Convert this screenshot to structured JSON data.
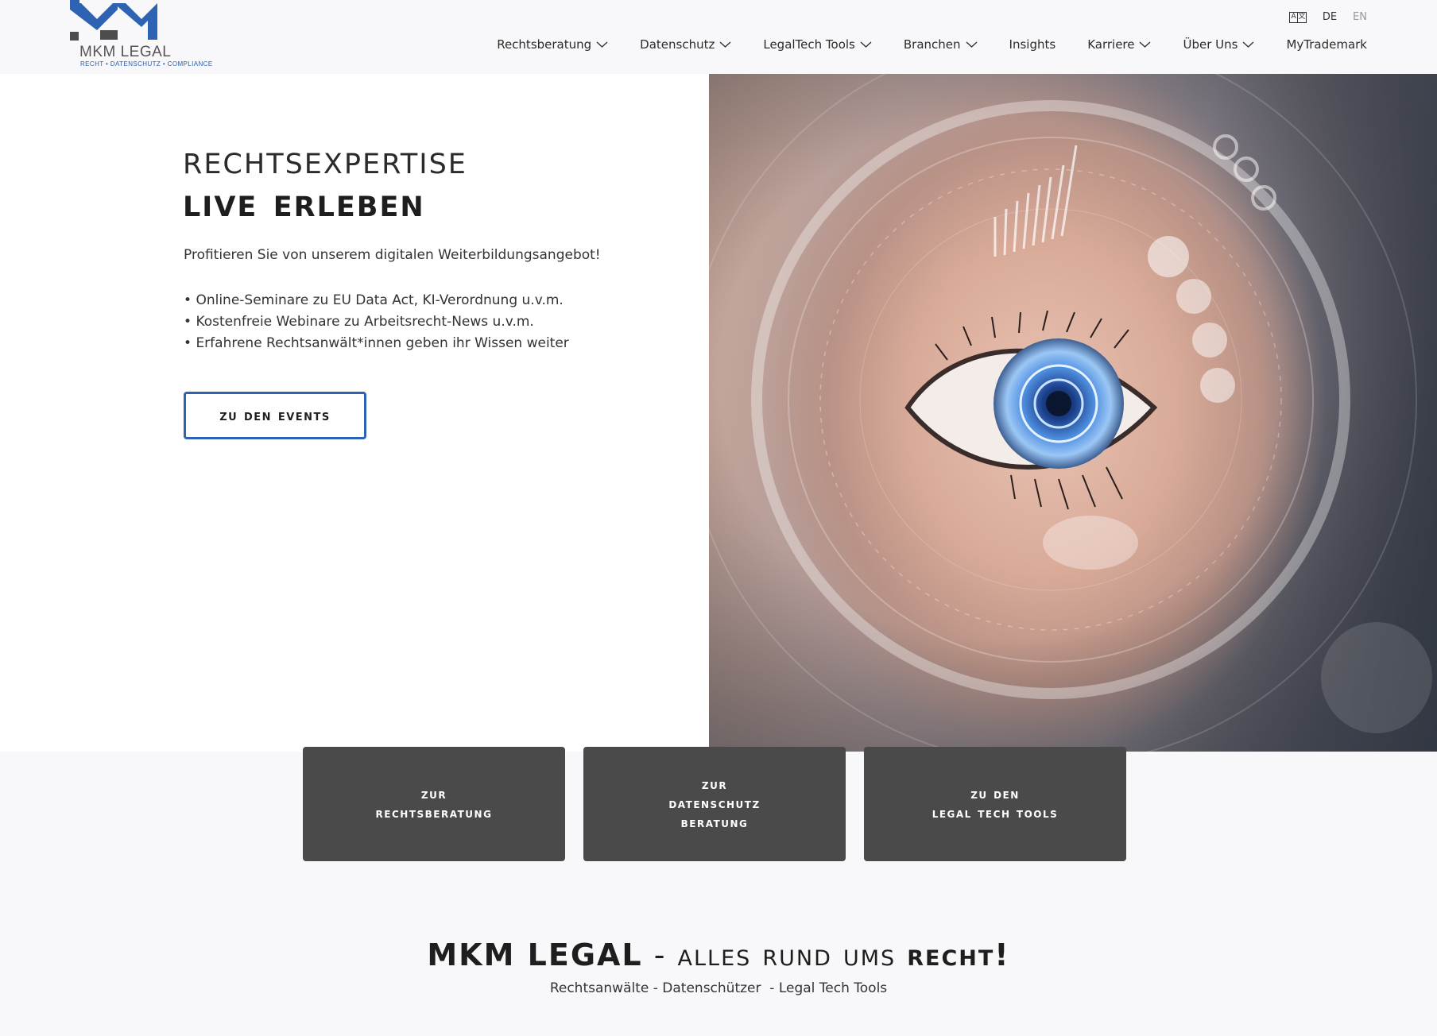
{
  "brand": {
    "name": "MKM LEGAL",
    "tagline": "RECHT • DATENSCHUTZ • COMPLIANCE",
    "accent_color": "#2e62b3"
  },
  "language": {
    "icon": "translate-icon",
    "options": [
      "DE",
      "EN"
    ],
    "active": "DE"
  },
  "nav": {
    "items": [
      {
        "label": "Rechtsberatung",
        "has_dropdown": true
      },
      {
        "label": "Datenschutz",
        "has_dropdown": true
      },
      {
        "label": "LegalTech Tools",
        "has_dropdown": true
      },
      {
        "label": "Branchen",
        "has_dropdown": true
      },
      {
        "label": "Insights",
        "has_dropdown": false
      },
      {
        "label": "Karriere",
        "has_dropdown": true
      },
      {
        "label": "Über Uns",
        "has_dropdown": true
      },
      {
        "label": "MyTrademark",
        "has_dropdown": false
      }
    ]
  },
  "hero": {
    "title_line1": "Rechtsexpertise",
    "title_line2": "live erleben",
    "intro": "Profitieren Sie von unserem digitalen Weiterbildungsangebot!",
    "bullets": [
      "Online-Seminare zu EU Data Act, KI-Verordnung u.v.m.",
      "Kostenfreie Webinare zu Arbeitsrecht-News u.v.m.",
      "Erfahrene Rechtsanwält*innen geben ihr Wissen weiter"
    ],
    "cta_label": "zu den Events",
    "image_subject": "eye-with-digital-overlay"
  },
  "tiles": [
    {
      "label": "zur\nRechtsberatung"
    },
    {
      "label": "zur\nDatenschutz\nBeratung"
    },
    {
      "label": "zu den\nLegal Tech Tools"
    }
  ],
  "bottom": {
    "title_brand": "MKM LEGAL",
    "title_dash": " - ",
    "title_middle": "Alles rund ums ",
    "title_end": "Recht!",
    "subtitle": "Rechtsanwälte - Datenschützer  - Legal Tech Tools"
  }
}
